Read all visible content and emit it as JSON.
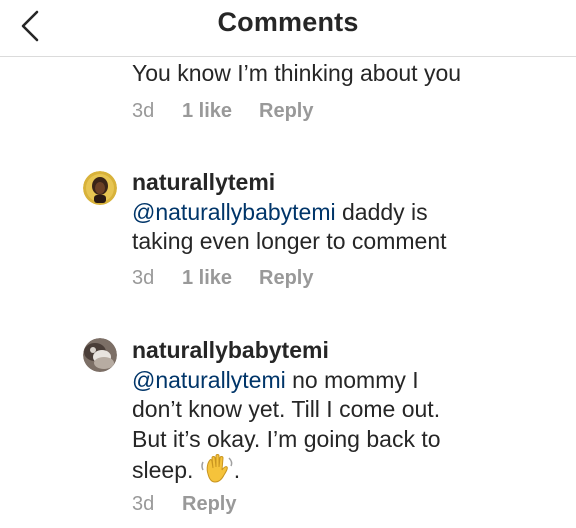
{
  "header": {
    "title": "Comments"
  },
  "comments": [
    {
      "username": "",
      "text": "You know I’m thinking about you",
      "time": "3d",
      "likes": "1 like",
      "reply": "Reply"
    },
    {
      "username": "naturallytemi",
      "mention": "@naturallybabytemi",
      "text_line1_rest": " daddy is",
      "text_line2": "taking even longer to comment",
      "time": "3d",
      "likes": "1 like",
      "reply": "Reply"
    },
    {
      "username": "naturallybabytemi",
      "mention": "@naturallytemi",
      "text_line1_rest": " no mommy I",
      "text_line2": "don’t know yet. Till I come out.",
      "text_line3": "But it’s okay. I’m going back to",
      "text_line4": "sleep.",
      "text_line4_after": ".",
      "emoji": "waving-hand-icon",
      "time": "3d",
      "reply": "Reply"
    }
  ],
  "colors": {
    "text": "#262626",
    "mention": "#003569",
    "meta": "#999999",
    "divider": "#dbdbdb"
  }
}
